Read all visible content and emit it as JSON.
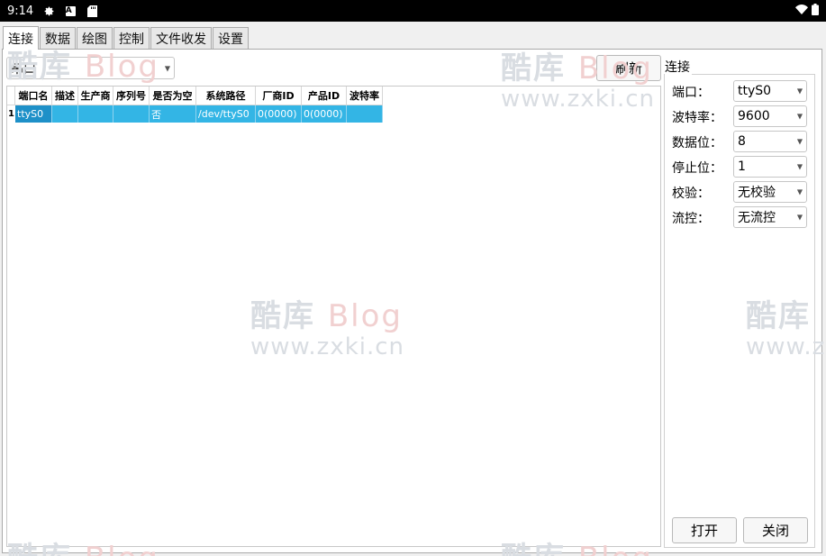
{
  "status_bar": {
    "time": "9:14",
    "icons": [
      "gear-icon",
      "a-icon",
      "sd-card-icon"
    ],
    "right_icons": [
      "wifi-icon",
      "battery-icon"
    ]
  },
  "tabs": [
    {
      "label": "连接",
      "active": true
    },
    {
      "label": "数据",
      "active": false
    },
    {
      "label": "绘图",
      "active": false
    },
    {
      "label": "控制",
      "active": false
    },
    {
      "label": "文件收发",
      "active": false
    },
    {
      "label": "设置",
      "active": false
    }
  ],
  "port_type": {
    "value": "串口"
  },
  "refresh_label": "刷新",
  "table": {
    "headers": [
      "端口名",
      "描述",
      "生产商",
      "序列号",
      "是否为空",
      "系统路径",
      "厂商ID",
      "产品ID",
      "波特率"
    ],
    "rows": [
      {
        "index": "1",
        "cells": [
          "ttyS0",
          "",
          "",
          "",
          "否",
          "/dev/ttyS0",
          "0(0000)",
          "0(0000)",
          ""
        ]
      }
    ]
  },
  "connection": {
    "title": "连接",
    "port_label": "端口：",
    "port_value": "ttyS0",
    "baud_label": "波特率：",
    "baud_value": "9600",
    "databits_label": "数据位：",
    "databits_value": "8",
    "stopbits_label": "停止位：",
    "stopbits_value": "1",
    "parity_label": "校验：",
    "parity_value": "无校验",
    "flow_label": "流控：",
    "flow_value": "无流控",
    "open_label": "打开",
    "close_label": "关闭"
  },
  "watermark": {
    "brand_cn": "酷库",
    "brand_en": "Blog",
    "url": "www.zxki.cn"
  },
  "colors": {
    "selection": "#33b5e5",
    "status_bar": "#000000"
  }
}
